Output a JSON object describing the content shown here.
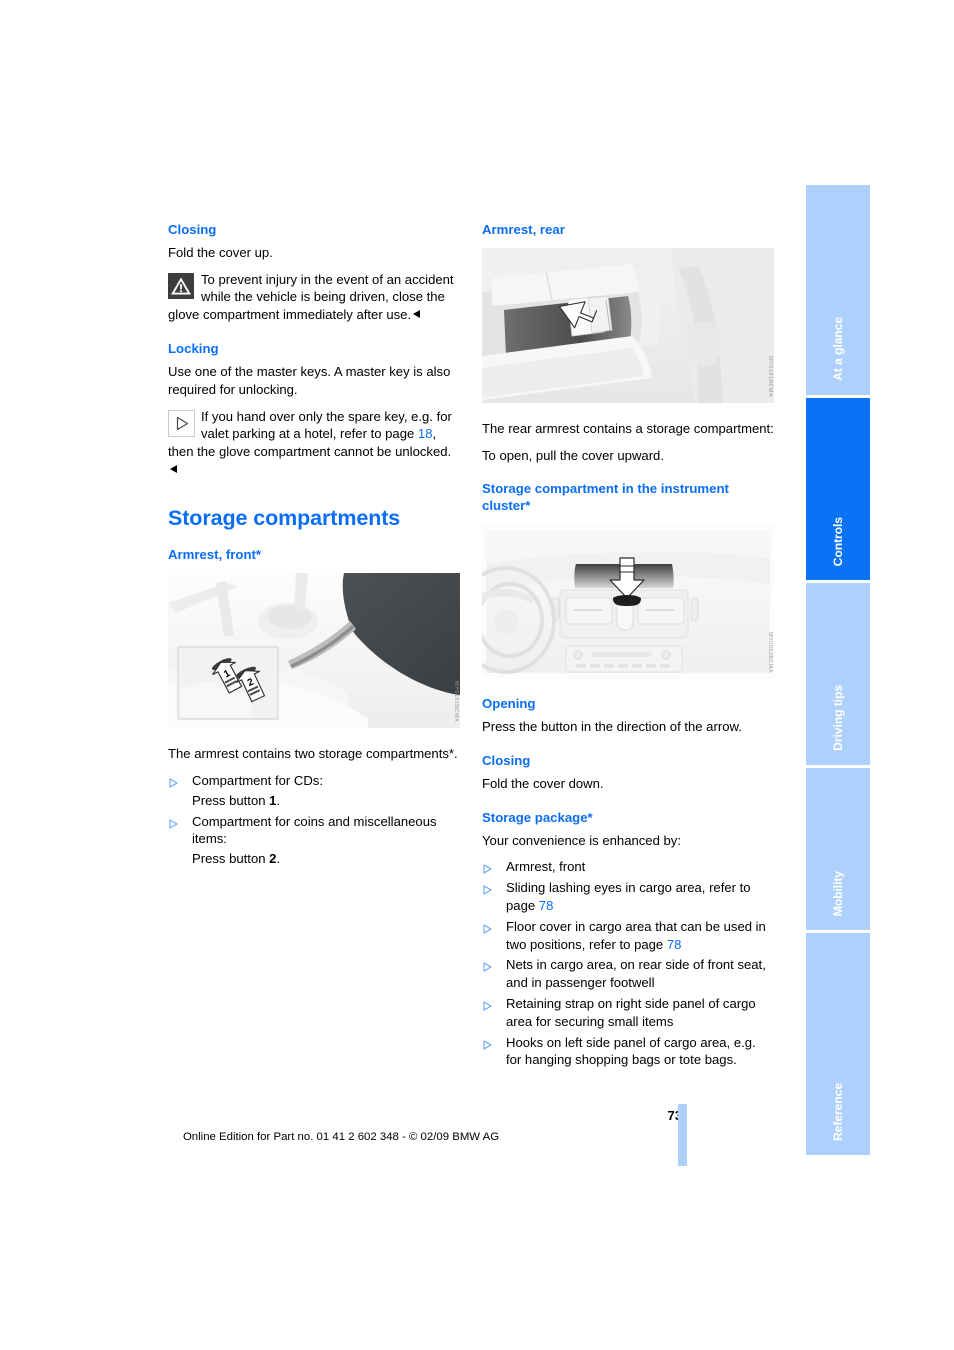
{
  "document": {
    "page_number": "73",
    "footer_line": "Online Edition for Part no. 01 41 2 602 348 - © 02/09 BMW AG"
  },
  "colors": {
    "heading_blue": "#0a6ef5",
    "tab_active": "#0a72f5",
    "tab_inactive": "#aed0fd",
    "warning_box": "#3d3d3d"
  },
  "side_tabs": [
    {
      "label": "At a glance",
      "active": false
    },
    {
      "label": "Controls",
      "active": true
    },
    {
      "label": "Driving tips",
      "active": false
    },
    {
      "label": "Mobility",
      "active": false
    },
    {
      "label": "Reference",
      "active": false
    }
  ],
  "left_column": {
    "closing": {
      "heading": "Closing",
      "body": "Fold the cover up.",
      "warning": {
        "icon": "warning-triangle-icon",
        "text": "To prevent injury in the event of an accident while the vehicle is being driven, close the glove compartment immediately after use."
      }
    },
    "locking": {
      "heading": "Locking",
      "body": "Use one of the master keys. A master key is also required for unlocking.",
      "note": {
        "icon": "reference-triangle-icon",
        "text_part1": "If you hand over only the spare key, e.g. for valet parking at a hotel, refer to page ",
        "page_ref": "18",
        "text_part2": ", then the glove compartment cannot be unlocked."
      }
    },
    "storage_compartments": {
      "heading": "Storage compartments",
      "armrest_front": {
        "heading": "Armrest, front*",
        "figure_watermark": "MY0191BCMA",
        "intro": "The armrest contains two storage compartments*.",
        "bullets": [
          {
            "main": "Compartment for CDs:",
            "sub": "Press button 1.",
            "sub_bold": "1"
          },
          {
            "main": "Compartment for coins and miscellaneous items:",
            "sub": "Press button 2.",
            "sub_bold": "2"
          }
        ]
      }
    }
  },
  "right_column": {
    "armrest_rear": {
      "heading": "Armrest, rear",
      "figure_watermark": "MY0191BCMA",
      "body1": "The rear armrest contains a storage compartment:",
      "body2": "To open, pull the cover upward."
    },
    "instrument_cluster": {
      "heading": "Storage compartment in the instrument cluster*",
      "figure_watermark": "MY0092BCMA",
      "opening": {
        "heading": "Opening",
        "body": "Press the button in the direction of the arrow."
      },
      "closing": {
        "heading": "Closing",
        "body": "Fold the cover down."
      }
    },
    "storage_package": {
      "heading": "Storage package*",
      "intro": "Your convenience is enhanced by:",
      "bullets": [
        {
          "text": "Armrest, front"
        },
        {
          "text_before": "Sliding lashing eyes in cargo area, refer to page ",
          "page_ref": "78",
          "text_after": ""
        },
        {
          "text_before": "Floor cover in cargo area that can be used in two positions, refer to page ",
          "page_ref": "78",
          "text_after": ""
        },
        {
          "text": "Nets in cargo area, on rear side of front seat, and in passenger footwell"
        },
        {
          "text": "Retaining strap on right side panel of cargo area for securing small items"
        },
        {
          "text": "Hooks on left side panel of cargo area, e.g. for hanging shopping bags or tote bags."
        }
      ]
    }
  }
}
